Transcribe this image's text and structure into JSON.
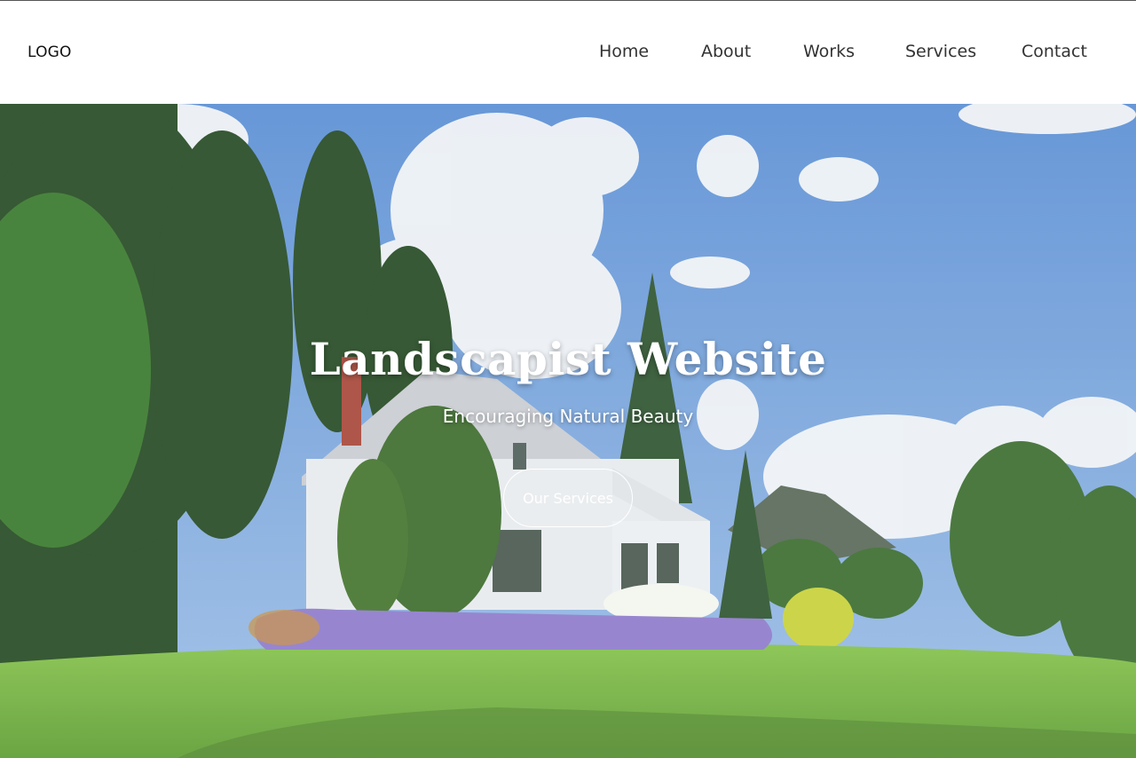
{
  "header": {
    "logo": "LOGO",
    "nav": [
      {
        "label": "Home"
      },
      {
        "label": "About"
      },
      {
        "label": "Works"
      },
      {
        "label": "Services"
      },
      {
        "label": "Contact"
      }
    ]
  },
  "hero": {
    "title": "Landscapist Website",
    "subtitle": "Encouraging Natural Beauty",
    "cta_label": "Our Services",
    "image": "house-garden-landscape"
  },
  "colors": {
    "sky": "#6a9ad8",
    "lawn": "#7fc043",
    "trees": "#2e5a2a",
    "lavender": "#8a76c8",
    "text": "#333333"
  }
}
